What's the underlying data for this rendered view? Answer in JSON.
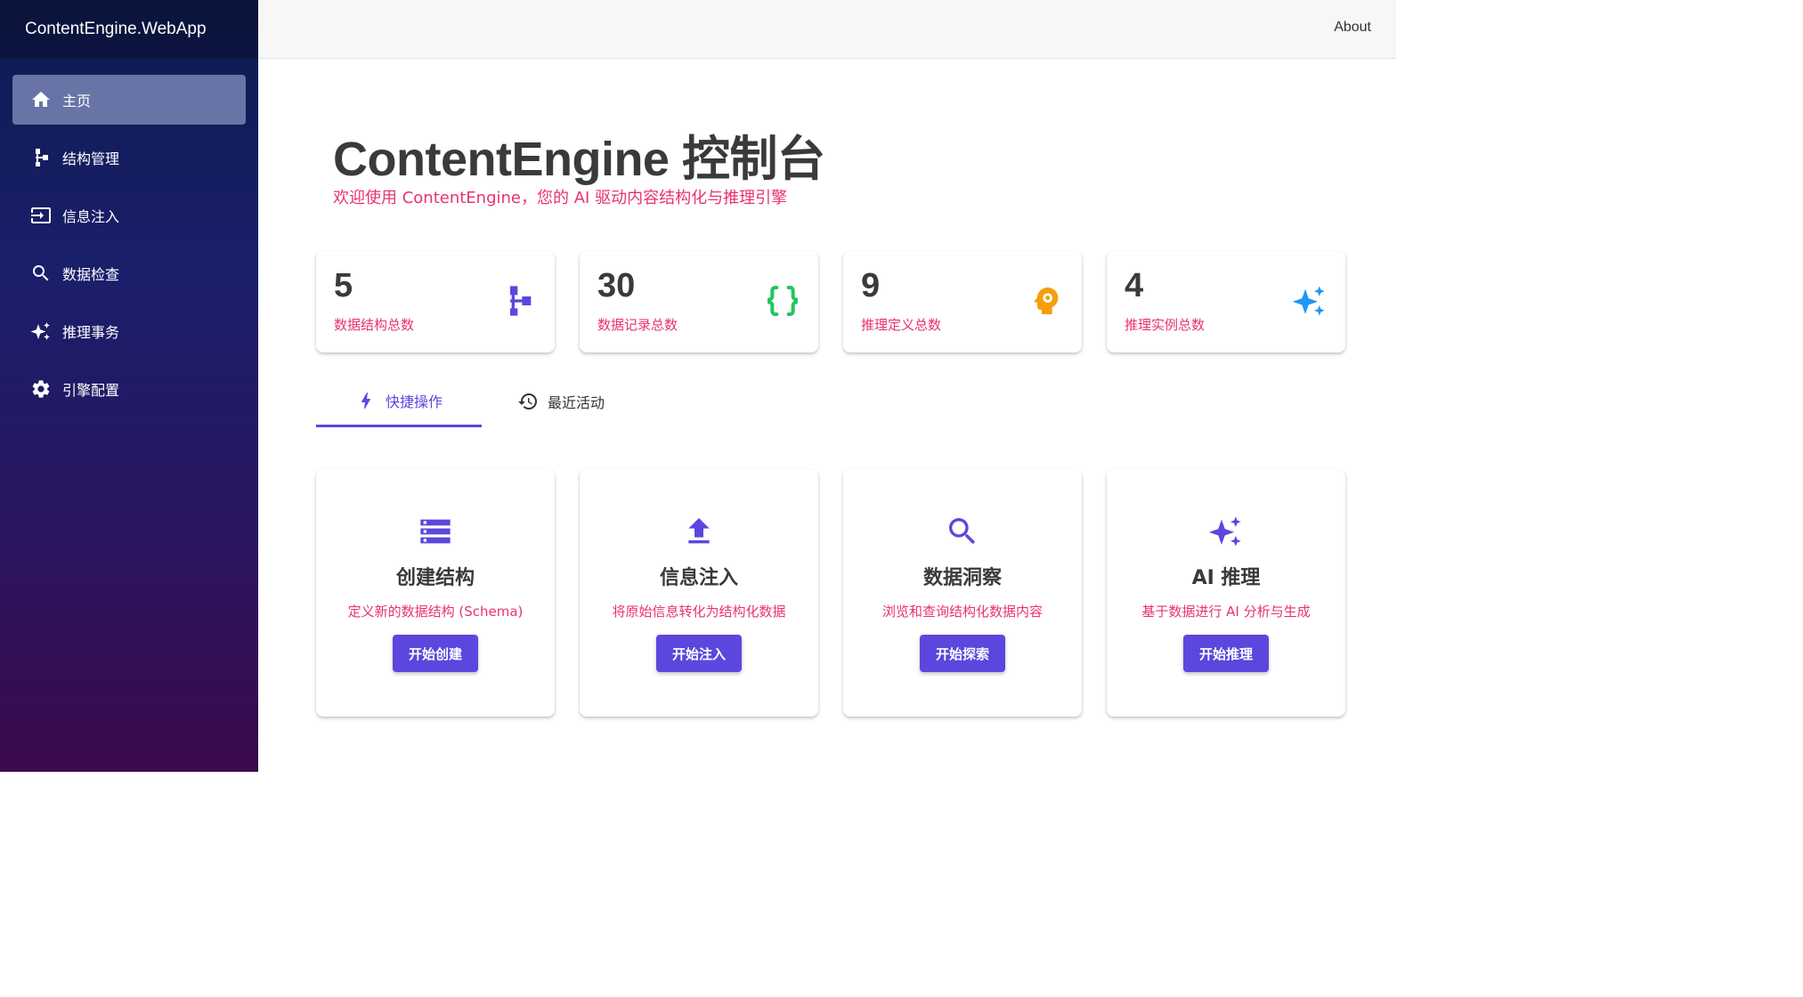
{
  "app": {
    "brand": "ContentEngine.WebApp"
  },
  "sidebar": {
    "items": [
      {
        "label": "主页",
        "icon": "home-icon",
        "active": true
      },
      {
        "label": "结构管理",
        "icon": "schema-icon"
      },
      {
        "label": "信息注入",
        "icon": "input-icon"
      },
      {
        "label": "数据检查",
        "icon": "search-icon"
      },
      {
        "label": "推理事务",
        "icon": "sparkles-icon"
      },
      {
        "label": "引擎配置",
        "icon": "gear-icon"
      }
    ]
  },
  "topbar": {
    "about": "About"
  },
  "header": {
    "title": "ContentEngine 控制台",
    "subtitle": "欢迎使用 ContentEngine，您的 AI 驱动内容结构化与推理引擎"
  },
  "stats": [
    {
      "value": "5",
      "label": "数据结构总数",
      "icon": "schema-icon",
      "color": "#5b47dd"
    },
    {
      "value": "30",
      "label": "数据记录总数",
      "icon": "braces-icon",
      "color": "#22c55e"
    },
    {
      "value": "9",
      "label": "推理定义总数",
      "icon": "psychology-icon",
      "color": "#f59e0b"
    },
    {
      "value": "4",
      "label": "推理实例总数",
      "icon": "sparkles-icon",
      "color": "#2196f3"
    }
  ],
  "tabs": [
    {
      "label": "快捷操作",
      "icon": "bolt-icon",
      "active": true
    },
    {
      "label": "最近活动",
      "icon": "history-icon"
    }
  ],
  "actions": [
    {
      "title": "创建结构",
      "description": "定义新的数据结构 (Schema)",
      "button": "开始创建",
      "icon": "storage-icon"
    },
    {
      "title": "信息注入",
      "description": "将原始信息转化为结构化数据",
      "button": "开始注入",
      "icon": "upload-icon"
    },
    {
      "title": "数据洞察",
      "description": "浏览和查询结构化数据内容",
      "button": "开始探索",
      "icon": "search-icon"
    },
    {
      "title": "AI 推理",
      "description": "基于数据进行 AI 分析与生成",
      "button": "开始推理",
      "icon": "sparkles-icon"
    }
  ],
  "colors": {
    "accent": "#5b47dd",
    "subtitle": "#e8336b"
  }
}
